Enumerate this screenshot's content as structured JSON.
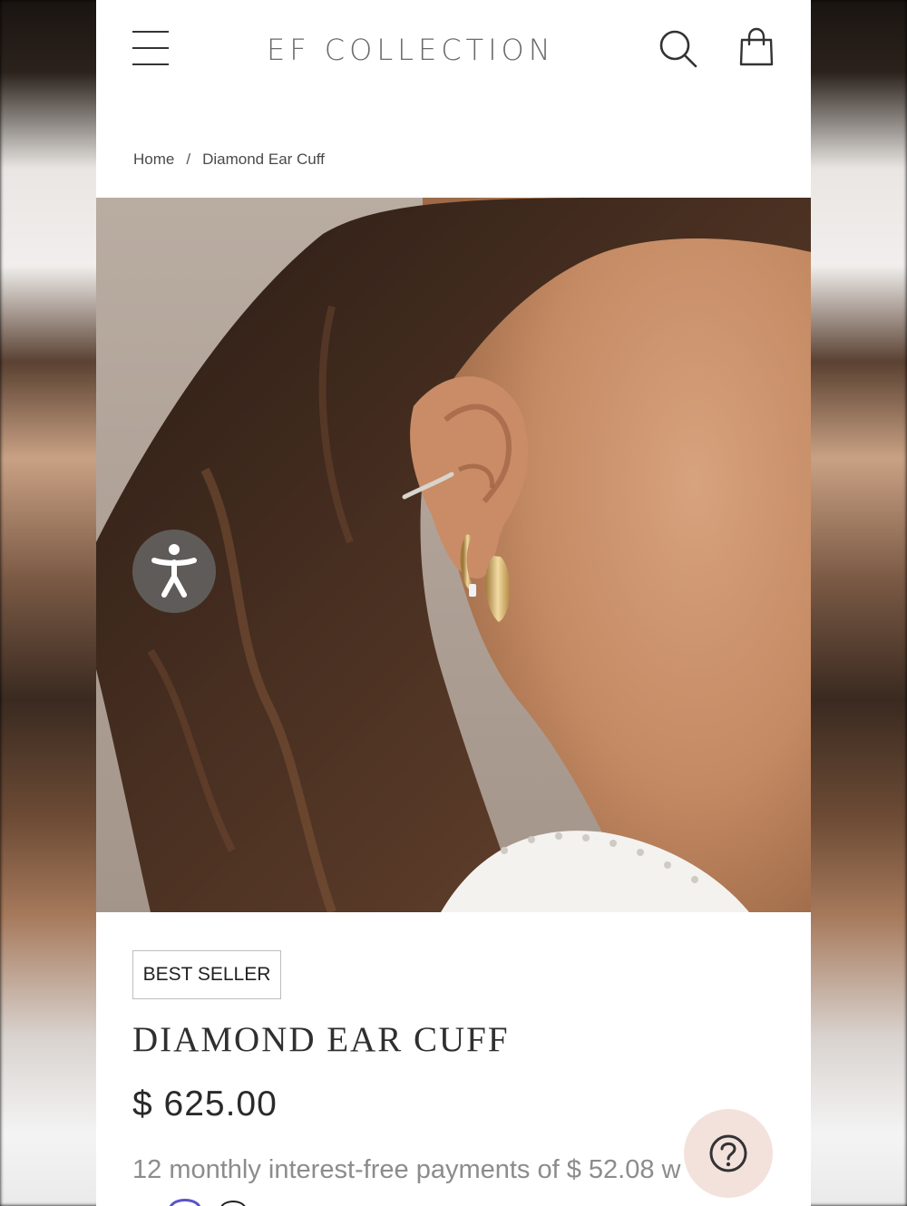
{
  "header": {
    "brand": "EF COLLECTION",
    "menu_icon": "hamburger-menu-icon",
    "search_icon": "search-icon",
    "cart_icon": "shopping-bag-icon"
  },
  "breadcrumb": {
    "home": "Home",
    "separator": "/",
    "current": "Diamond Ear Cuff"
  },
  "hero": {
    "image_icon": "product-photo-ear-cuff",
    "accessibility_icon": "accessibility-person-icon"
  },
  "product": {
    "badge": "BEST SELLER",
    "title": "DIAMOND EAR CUFF",
    "price": "$ 625.00",
    "installments_text": "12 monthly interest-free payments of $ 52.08 w"
  },
  "help": {
    "icon": "question-mark-icon"
  },
  "colors": {
    "page_bg": "#ffffff",
    "text": "#2c2c2c",
    "muted_text": "#8c8c8c",
    "brand_text": "#6a6a6a",
    "a11y_bg": "#5f5b58",
    "help_bg": "#f3e2dc",
    "badge_border": "#bdbdbd"
  }
}
